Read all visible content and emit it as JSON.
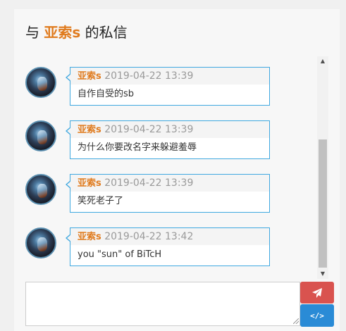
{
  "header": {
    "prefix": "与",
    "name": "亚索s",
    "suffix": "的私信"
  },
  "messages": [
    {
      "sender": "亚索s",
      "time": "2019-04-22 13:39",
      "text": "自作自受的sb"
    },
    {
      "sender": "亚索s",
      "time": "2019-04-22 13:39",
      "text": "为什么你要改名字来躲避羞辱"
    },
    {
      "sender": "亚索s",
      "time": "2019-04-22 13:39",
      "text": "笑死老子了"
    },
    {
      "sender": "亚索s",
      "time": "2019-04-22 13:42",
      "text": "you \"sun\" of BiTcH"
    }
  ],
  "composer": {
    "value": "",
    "send_icon": "paper-plane-icon",
    "code_icon": "code-icon",
    "code_label": "</>"
  },
  "colors": {
    "accent_name": "#e07b1e",
    "bubble_border": "#3fa8e0",
    "send_button": "#d9534f",
    "code_button": "#2a8bd6"
  }
}
